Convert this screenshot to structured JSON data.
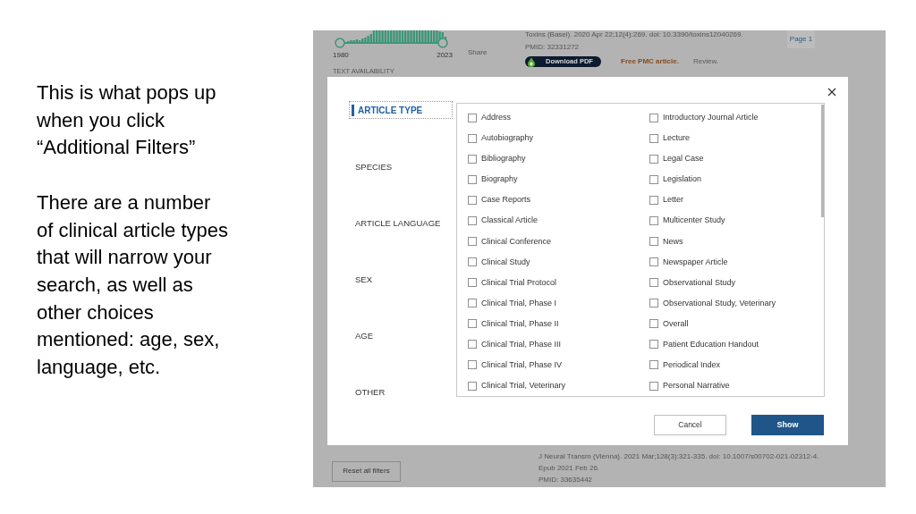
{
  "slide": {
    "paragraphs": [
      "This is what pops up\nwhen you click\n“Additional Filters”",
      "There are a number\nof clinical article types\nthat will narrow your\nsearch, as well as\nother choices\nmentioned: age, sex,\nlanguage, etc."
    ]
  },
  "screenshot": {
    "results_top": {
      "year_range": {
        "start": "1980",
        "end": "2023"
      },
      "section_heading": "TEXT AVAILABILITY",
      "share": "Share",
      "citation": "Toxins (Basel). 2020 Apr 22;12(4):269. doi: 10.3390/toxins12040269.",
      "pmid": "PMID: 32331272",
      "download_button": "Download PDF",
      "access": "Free PMC article.",
      "article_type": "Review.",
      "page": "Page 1"
    },
    "dialog": {
      "categories": [
        {
          "label": "ARTICLE TYPE",
          "selected": true
        },
        {
          "label": "SPECIES",
          "selected": false
        },
        {
          "label": "ARTICLE LANGUAGE",
          "selected": false
        },
        {
          "label": "SEX",
          "selected": false
        },
        {
          "label": "AGE",
          "selected": false
        },
        {
          "label": "OTHER",
          "selected": false
        }
      ],
      "option_columns": [
        [
          {
            "label": "Address",
            "checked": false
          },
          {
            "label": "Autobiography",
            "checked": false
          },
          {
            "label": "Bibliography",
            "checked": false
          },
          {
            "label": "Biography",
            "checked": false
          },
          {
            "label": "Case Reports",
            "checked": false
          },
          {
            "label": "Classical Article",
            "checked": false
          },
          {
            "label": "Clinical Conference",
            "checked": false
          },
          {
            "label": "Clinical Study",
            "checked": false
          },
          {
            "label": "Clinical Trial Protocol",
            "checked": false
          },
          {
            "label": "Clinical Trial, Phase I",
            "checked": false
          },
          {
            "label": "Clinical Trial, Phase II",
            "checked": false
          },
          {
            "label": "Clinical Trial, Phase III",
            "checked": false
          },
          {
            "label": "Clinical Trial, Phase IV",
            "checked": false
          },
          {
            "label": "Clinical Trial, Veterinary",
            "checked": false
          }
        ],
        [
          {
            "label": "Introductory Journal Article",
            "checked": false
          },
          {
            "label": "Lecture",
            "checked": false
          },
          {
            "label": "Legal Case",
            "checked": false
          },
          {
            "label": "Legislation",
            "checked": false
          },
          {
            "label": "Letter",
            "checked": false
          },
          {
            "label": "Multicenter Study",
            "checked": false
          },
          {
            "label": "News",
            "checked": false
          },
          {
            "label": "Newspaper Article",
            "checked": false
          },
          {
            "label": "Observational Study",
            "checked": false
          },
          {
            "label": "Observational Study, Veterinary",
            "checked": false
          },
          {
            "label": "Overall",
            "checked": false
          },
          {
            "label": "Patient Education Handout",
            "checked": false
          },
          {
            "label": "Periodical Index",
            "checked": false
          },
          {
            "label": "Personal Narrative",
            "checked": false
          }
        ]
      ],
      "buttons": [
        {
          "label": "Cancel",
          "kind": "secondary"
        },
        {
          "label": "Show",
          "kind": "primary"
        }
      ]
    },
    "results_bottom": {
      "reset_button": "Reset all filters",
      "citation_lines": [
        "J Neural Transm (Vienna). 2021 Mar;128(3):321-335. doi: 10.1007/s00702-021-02312-4.",
        "Epub 2021 Feb 26.",
        "PMID: 33635442"
      ]
    }
  }
}
